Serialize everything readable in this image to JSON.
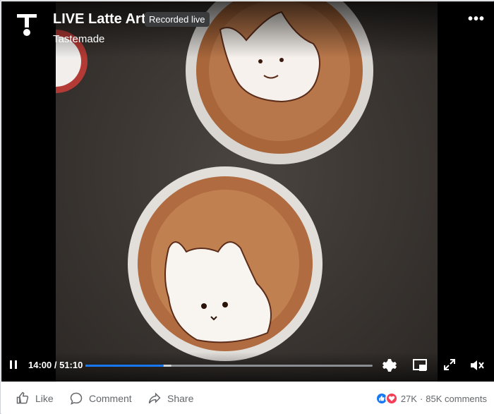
{
  "video": {
    "title": "LIVE Latte Art",
    "badge": "Recorded live",
    "author": "Tastemade",
    "time_current": "14:00",
    "time_total": "51:10",
    "progress_played": 0.273,
    "progress_buffered": 0.3,
    "brand_color": "#1877f2"
  },
  "actions": {
    "like": "Like",
    "comment": "Comment",
    "share": "Share"
  },
  "stats": {
    "reactions_count": "27K",
    "separator": "·",
    "comments": "85K comments"
  },
  "icons": {
    "logo": "tastemade-logo-icon",
    "more": "more-options-icon",
    "pause": "pause-icon",
    "settings": "gear-icon",
    "pip": "picture-in-picture-icon",
    "fullscreen": "fullscreen-icon",
    "volume": "volume-icon",
    "like": "thumbs-up-icon",
    "comment": "comment-bubble-icon",
    "share": "share-arrow-icon",
    "reaction_like": "like-reaction-icon",
    "reaction_love": "love-reaction-icon"
  }
}
